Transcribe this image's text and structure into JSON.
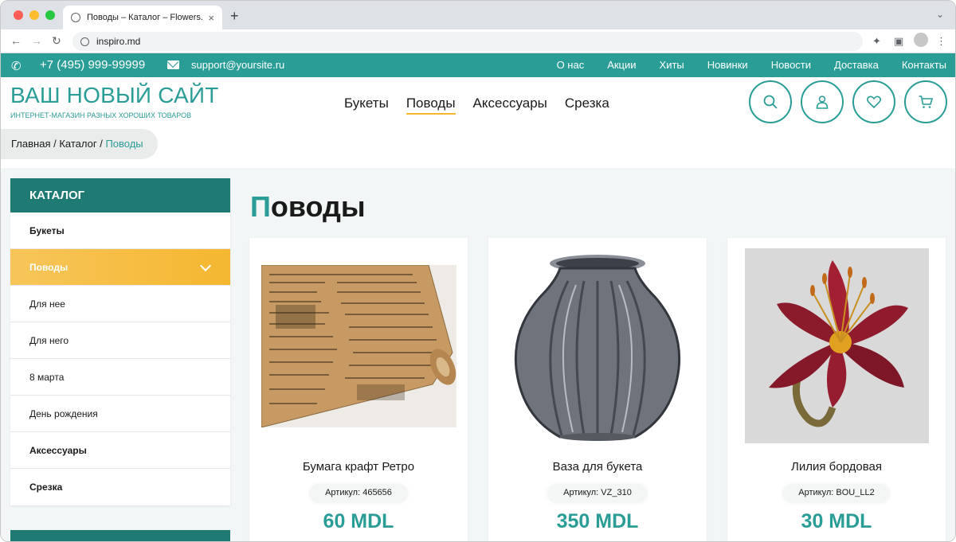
{
  "browser": {
    "tab_title": "Поводы – Каталог – Flowers.Inspiro",
    "tab_close": "×",
    "new_tab": "+",
    "url": "inspiro.md"
  },
  "topbar": {
    "phone": "+7 (495) 999-99999",
    "email": "support@yoursite.ru",
    "links": [
      "О нас",
      "Акции",
      "Хиты",
      "Новинки",
      "Новости",
      "Доставка",
      "Контакты"
    ]
  },
  "header": {
    "logo_title": "ВАШ НОВЫЙ САЙТ",
    "logo_subtitle": "ИНТЕРНЕТ-МАГАЗИН РАЗНЫХ ХОРОШИХ ТОВАРОВ",
    "nav": [
      "Букеты",
      "Поводы",
      "Аксессуары",
      "Срезка"
    ],
    "active_nav": "Поводы",
    "icons": [
      "search-icon",
      "user-icon",
      "heart-icon",
      "cart-icon"
    ]
  },
  "breadcrumb": {
    "items": [
      "Главная",
      "Каталог"
    ],
    "separator": " / ",
    "current": "Поводы"
  },
  "sidebar": {
    "title": "КАТАЛОГ",
    "items": [
      {
        "label": "Букеты",
        "bold": true
      },
      {
        "label": "Поводы",
        "active": true
      },
      {
        "label": "Для нее"
      },
      {
        "label": "Для него"
      },
      {
        "label": "8 марта"
      },
      {
        "label": "День рождения"
      },
      {
        "label": "Аксессуары",
        "bold": true
      },
      {
        "label": "Срезка",
        "bold": true
      }
    ]
  },
  "page": {
    "title_first": "П",
    "title_rest": "оводы"
  },
  "products": [
    {
      "name": "Бумага крафт Ретро",
      "sku": "Артикул: 465656",
      "price": "60 MDL"
    },
    {
      "name": "Ваза для букета",
      "sku": "Артикул: VZ_310",
      "price": "350 MDL"
    },
    {
      "name": "Лилия бордовая",
      "sku": "Артикул: BOU_LL2",
      "price": "30 MDL"
    }
  ],
  "colors": {
    "accent": "#2a9d96",
    "dark_accent": "#1f7a73",
    "highlight": "#f5b730"
  }
}
